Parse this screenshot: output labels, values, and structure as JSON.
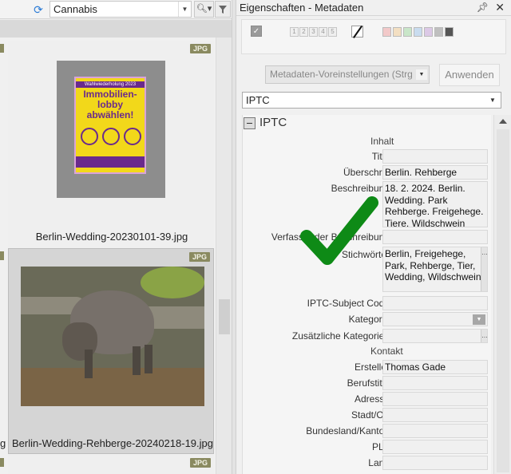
{
  "left_toolbar": {
    "filter_value": "Cannabis"
  },
  "thumbnails": [
    {
      "badge": "JPG",
      "filename": "Berlin-Wedding-20230101-39.jpg"
    },
    {
      "badge": "JPG",
      "filename": "Berlin-Wedding-Rehberge-20240218-19.jpg"
    },
    {
      "badge": "JPG"
    }
  ],
  "left_edge_text": "g",
  "poster": {
    "head": "Wahlwiederholung 2023",
    "title_line1": "Immobilien-",
    "title_line2": "lobby",
    "title_line3": "abwählen!"
  },
  "panel": {
    "title": "Eigenschaften - Metadaten",
    "rating_numbers": [
      "1",
      "2",
      "3",
      "4",
      "5"
    ],
    "color_labels": [
      "#f2c9c9",
      "#f3dfc2",
      "#c9e6c9",
      "#c9dcef",
      "#dcc9e6",
      "#bfbfbf",
      "#555555"
    ],
    "preset_select": "Metadaten-Voreinstellungen (Strg",
    "apply_button": "Anwenden",
    "schema_select": "IPTC"
  },
  "iptc": {
    "section_title": "IPTC",
    "group_content": "Inhalt",
    "group_contact": "Kontakt",
    "fields": {
      "titel": {
        "label": "Titel",
        "value": ""
      },
      "ueberschrift": {
        "label": "Überschrift",
        "value": "Berlin. Rehberge"
      },
      "beschreibung": {
        "label": "Beschreibung",
        "value": "18. 2. 2024. Berlin. Wedding. Park Rehberge.  Freigehege. Tiere. Wildschwein"
      },
      "verfasser": {
        "label": "Verfasser der Beschreibung",
        "value": ""
      },
      "stichwoerter": {
        "label": "Stichwörter",
        "value": "Berlin, Freigehege, Park, Rehberge, Tier, Wedding, Wildschwein"
      },
      "subject_code": {
        "label": "IPTC-Subject Code",
        "value": ""
      },
      "kategorie": {
        "label": "Kategorie",
        "value": ""
      },
      "zus_kategorien": {
        "label": "Zusätzliche Kategorien",
        "value": ""
      },
      "ersteller": {
        "label": "Ersteller",
        "value": "Thomas Gade"
      },
      "berufstitel": {
        "label": "Berufstitel",
        "value": ""
      },
      "adresse": {
        "label": "Adresse",
        "value": ""
      },
      "stadt": {
        "label": "Stadt/Ort",
        "value": ""
      },
      "bundesland": {
        "label": "Bundesland/Kanton",
        "value": ""
      },
      "plz": {
        "label": "PLZ",
        "value": ""
      },
      "land": {
        "label": "Land",
        "value": ""
      }
    }
  },
  "colors": {
    "check_green": "#0e8a16",
    "badge": "#8a8a60"
  }
}
